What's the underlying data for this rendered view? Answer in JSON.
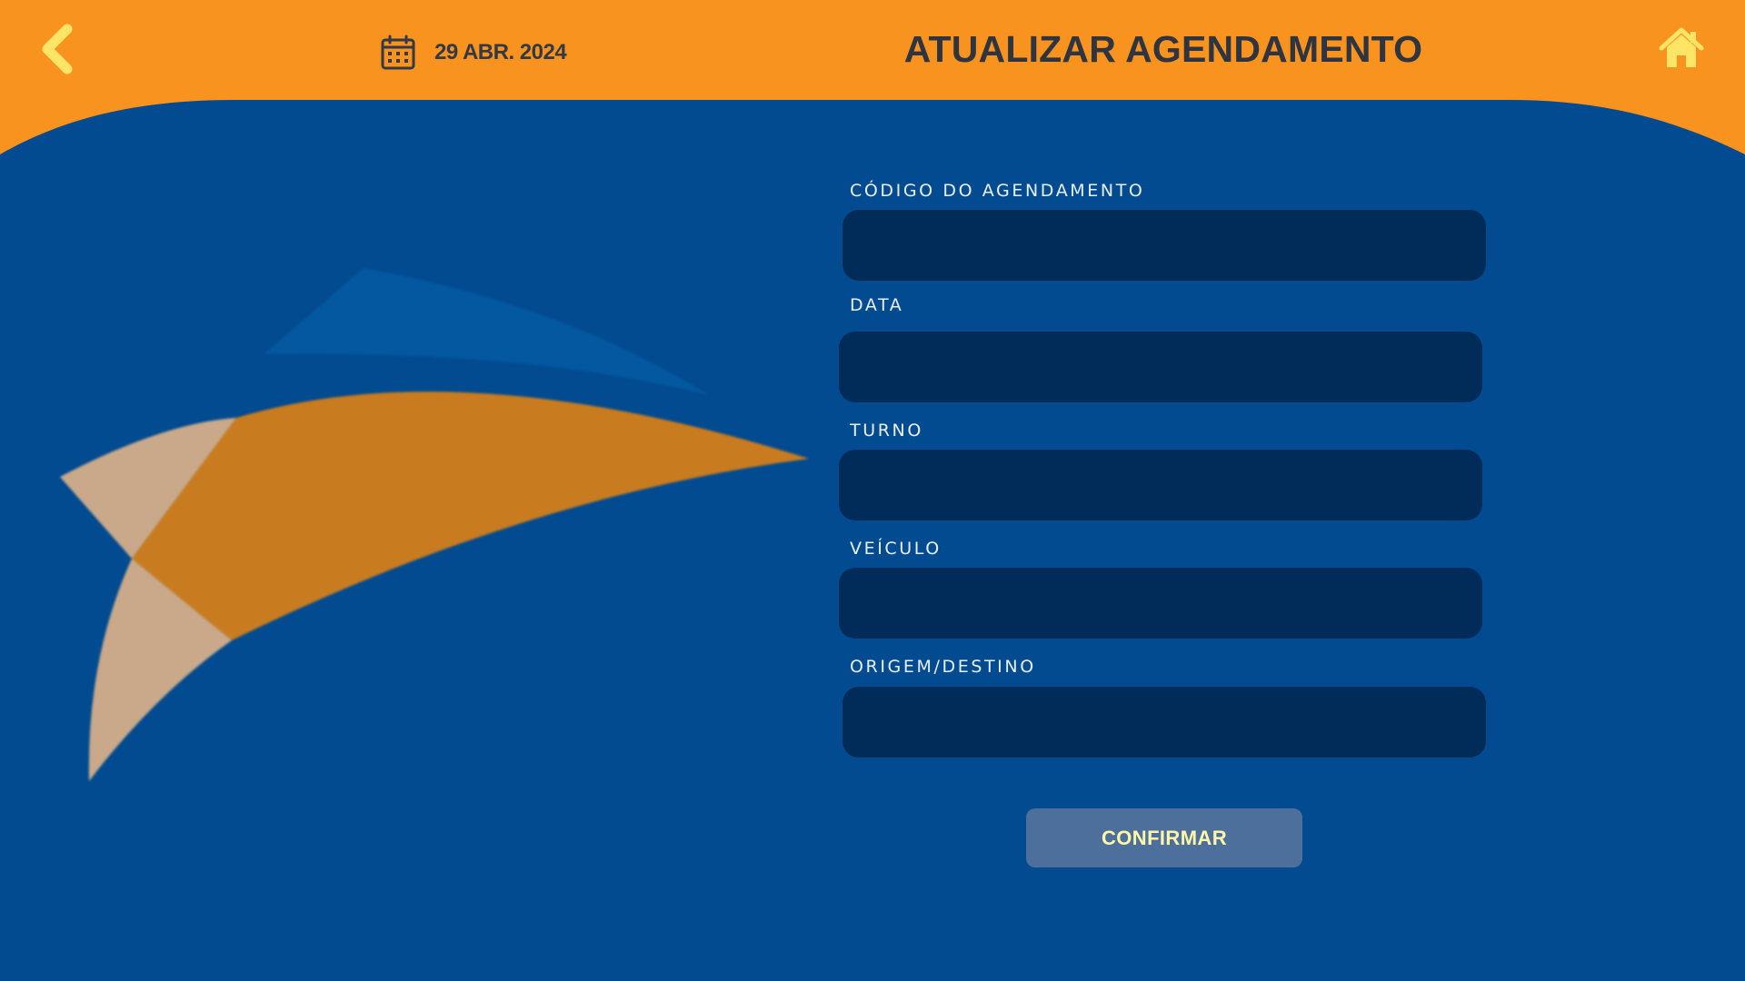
{
  "header": {
    "date": "29 ABR. 2024",
    "title": "ATUALIZAR AGENDAMENTO",
    "back_icon": "chevron-left-icon",
    "calendar_icon": "calendar-icon",
    "home_icon": "home-icon"
  },
  "form": {
    "fields": [
      {
        "label": "CÓDIGO DO AGENDAMENTO",
        "value": ""
      },
      {
        "label": "DATA",
        "value": ""
      },
      {
        "label": "TURNO",
        "value": ""
      },
      {
        "label": "VEÍCULO",
        "value": ""
      },
      {
        "label": "ORIGEM/DESTINO",
        "value": ""
      }
    ],
    "confirm_label": "CONFIRMAR"
  },
  "colors": {
    "header": "#f7931e",
    "background": "#024b90",
    "input": "#012c5a",
    "button": "#4d6f9b",
    "button_text": "#fff7a8",
    "icon_yellow": "#ffe566",
    "title_text": "#2f3540"
  }
}
